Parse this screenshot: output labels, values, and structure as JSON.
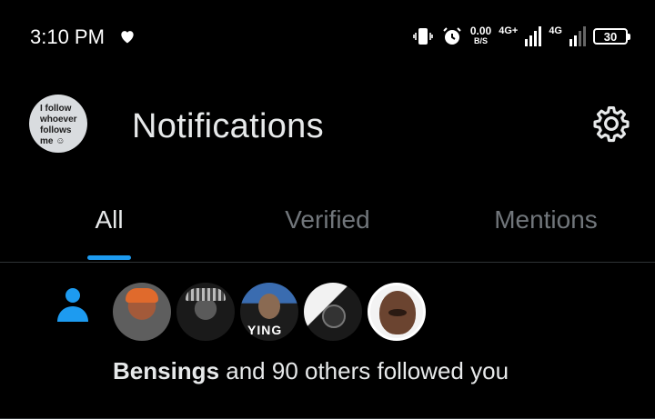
{
  "status_bar": {
    "time": "3:10 PM",
    "speed_value": "0.00",
    "speed_unit": "B/S",
    "network_1": "4G+",
    "network_2": "4G",
    "battery": "30",
    "icons": [
      "heart-icon",
      "vibrate-icon",
      "alarm-icon",
      "signal-icon",
      "signal-icon",
      "battery-icon"
    ]
  },
  "header": {
    "title": "Notifications",
    "avatar_text": [
      "I follow",
      "whoever",
      "follows",
      "me ☺"
    ],
    "settings_icon": "gear-icon"
  },
  "tabs": [
    {
      "label": "All",
      "active": true
    },
    {
      "label": "Verified",
      "active": false
    },
    {
      "label": "Mentions",
      "active": false
    }
  ],
  "colors": {
    "accent": "#1d9bf0",
    "background": "#000000",
    "text_primary": "#e7e9ea",
    "text_secondary": "#71767b"
  },
  "notification": {
    "icon": "person-icon",
    "name": "Bensings",
    "text": " and 90 others followed you",
    "avatar_count": 5
  }
}
